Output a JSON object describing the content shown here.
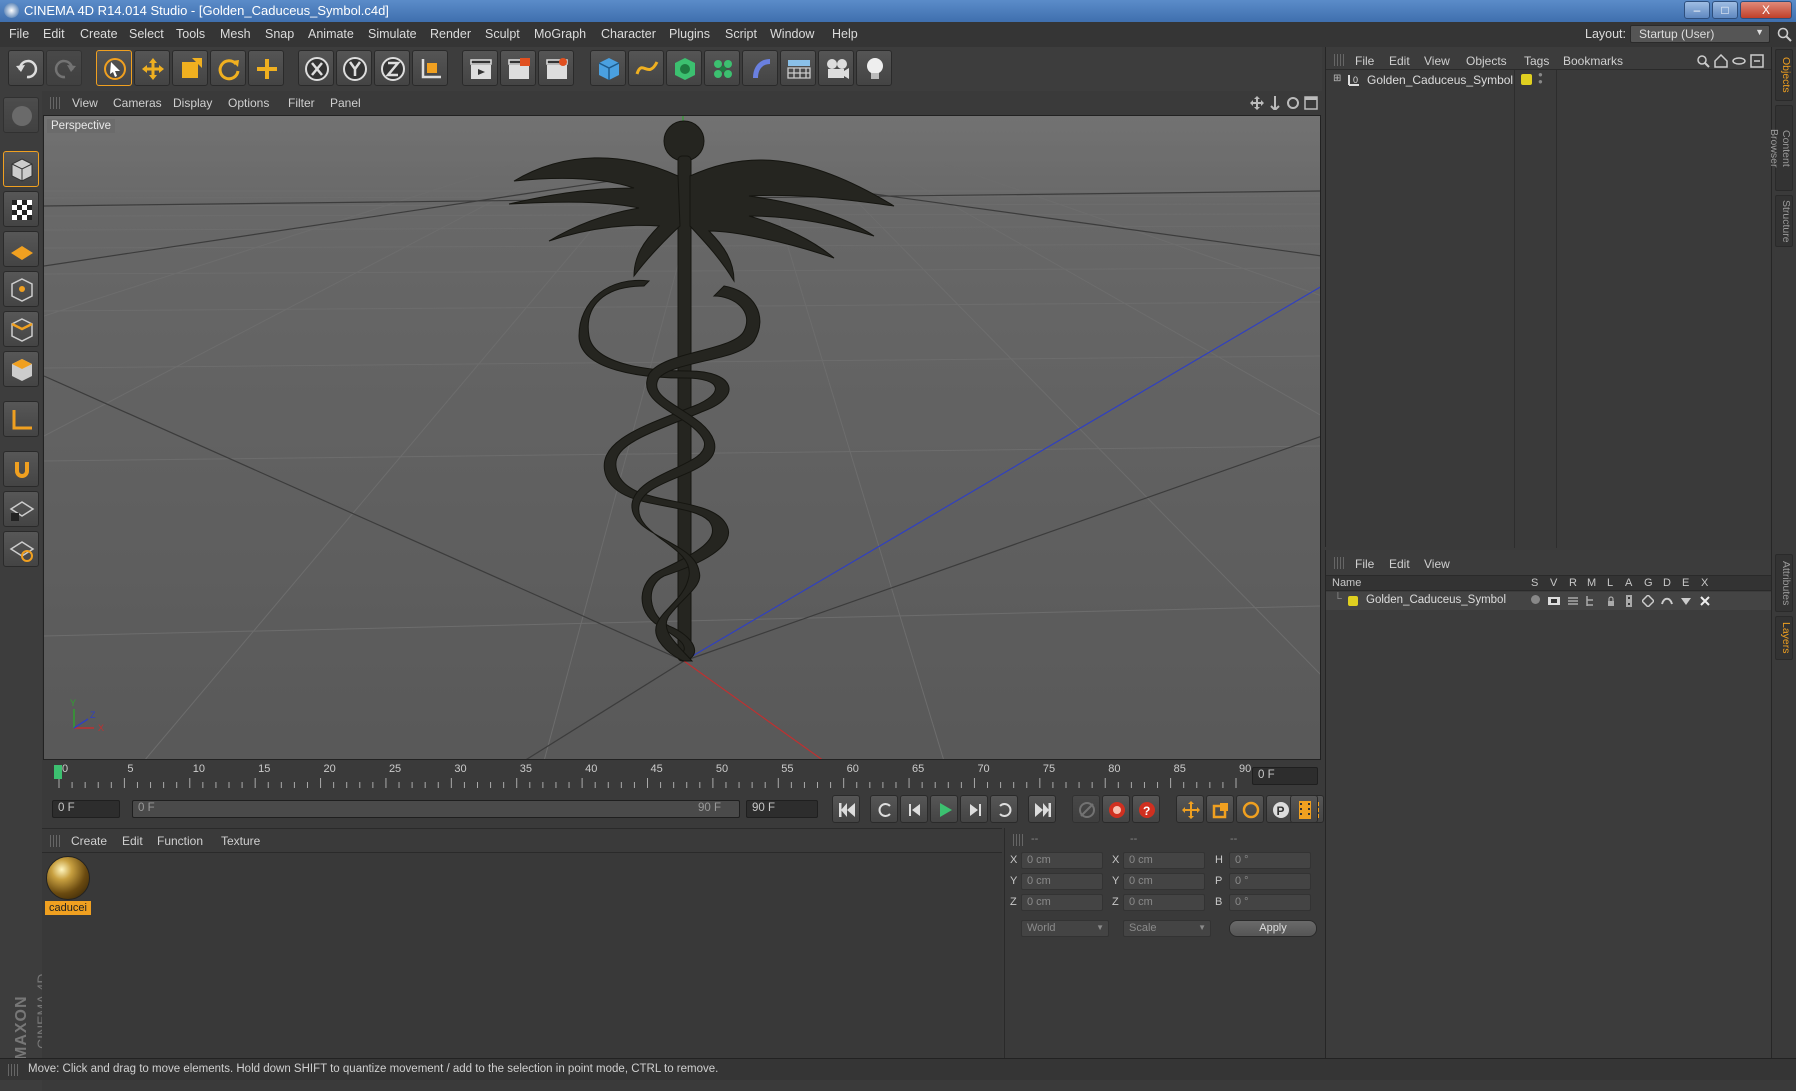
{
  "window": {
    "title": "CINEMA 4D R14.014 Studio - [Golden_Caduceus_Symbol.c4d]",
    "minimize": "–",
    "maximize": "□",
    "close": "X"
  },
  "menubar": {
    "items": [
      "File",
      "Edit",
      "Create",
      "Select",
      "Tools",
      "Mesh",
      "Snap",
      "Animate",
      "Simulate",
      "Render",
      "Sculpt",
      "MoGraph",
      "Character",
      "Plugins",
      "Script",
      "Window",
      "Help"
    ],
    "layout_label": "Layout:",
    "layout_value": "Startup (User)"
  },
  "viewport": {
    "menu": [
      "View",
      "Cameras",
      "Display",
      "Options",
      "Filter",
      "Panel"
    ],
    "label": "Perspective",
    "axis_x": "X",
    "axis_y": "Y",
    "axis_z": "Z"
  },
  "timeline": {
    "ticks": [
      "0",
      "5",
      "10",
      "15",
      "20",
      "25",
      "30",
      "35",
      "40",
      "45",
      "50",
      "55",
      "60",
      "65",
      "70",
      "75",
      "80",
      "85",
      "90"
    ],
    "current_frame": "0 F",
    "start_field": "0 F",
    "range_left": "0 F",
    "range_right": "90 F",
    "end_field": "90 F"
  },
  "material_manager": {
    "menu": [
      "Create",
      "Edit",
      "Function",
      "Texture"
    ],
    "material_name": "caducei"
  },
  "coordinates": {
    "header": [
      "--",
      "--",
      "--"
    ],
    "rows": [
      {
        "l1": "X",
        "v1": "0 cm",
        "l2": "X",
        "v2": "0 cm",
        "l3": "H",
        "v3": "0 °"
      },
      {
        "l1": "Y",
        "v1": "0 cm",
        "l2": "Y",
        "v2": "0 cm",
        "l3": "P",
        "v3": "0 °"
      },
      {
        "l1": "Z",
        "v1": "0 cm",
        "l2": "Z",
        "v2": "0 cm",
        "l3": "B",
        "v3": "0 °"
      }
    ],
    "mode1": "World",
    "mode2": "Scale",
    "apply": "Apply"
  },
  "object_manager": {
    "menu": [
      "File",
      "Edit",
      "View",
      "Objects",
      "Tags",
      "Bookmarks"
    ],
    "object_name": "Golden_Caduceus_Symbol",
    "object_color": "#e0d020"
  },
  "layer_manager": {
    "menu": [
      "File",
      "Edit",
      "View"
    ],
    "columns": [
      "Name",
      "S",
      "V",
      "R",
      "M",
      "L",
      "A",
      "G",
      "D",
      "E",
      "X"
    ],
    "layer_name": "Golden_Caduceus_Symbol",
    "layer_color": "#e0d020"
  },
  "side_tabs": [
    "Objects",
    "Content Browser",
    "Structure",
    "Attributes",
    "Layers"
  ],
  "branding": {
    "text1": "MAXON",
    "text2": "CINEMA 4D"
  },
  "status": "Move: Click and drag to move elements. Hold down SHIFT to quantize movement / add to the selection in point mode, CTRL to remove.",
  "colors": {
    "accent": "#f0a020",
    "axis_x": "#c03030",
    "axis_z": "#3040c0",
    "axis_y": "#30a030"
  }
}
